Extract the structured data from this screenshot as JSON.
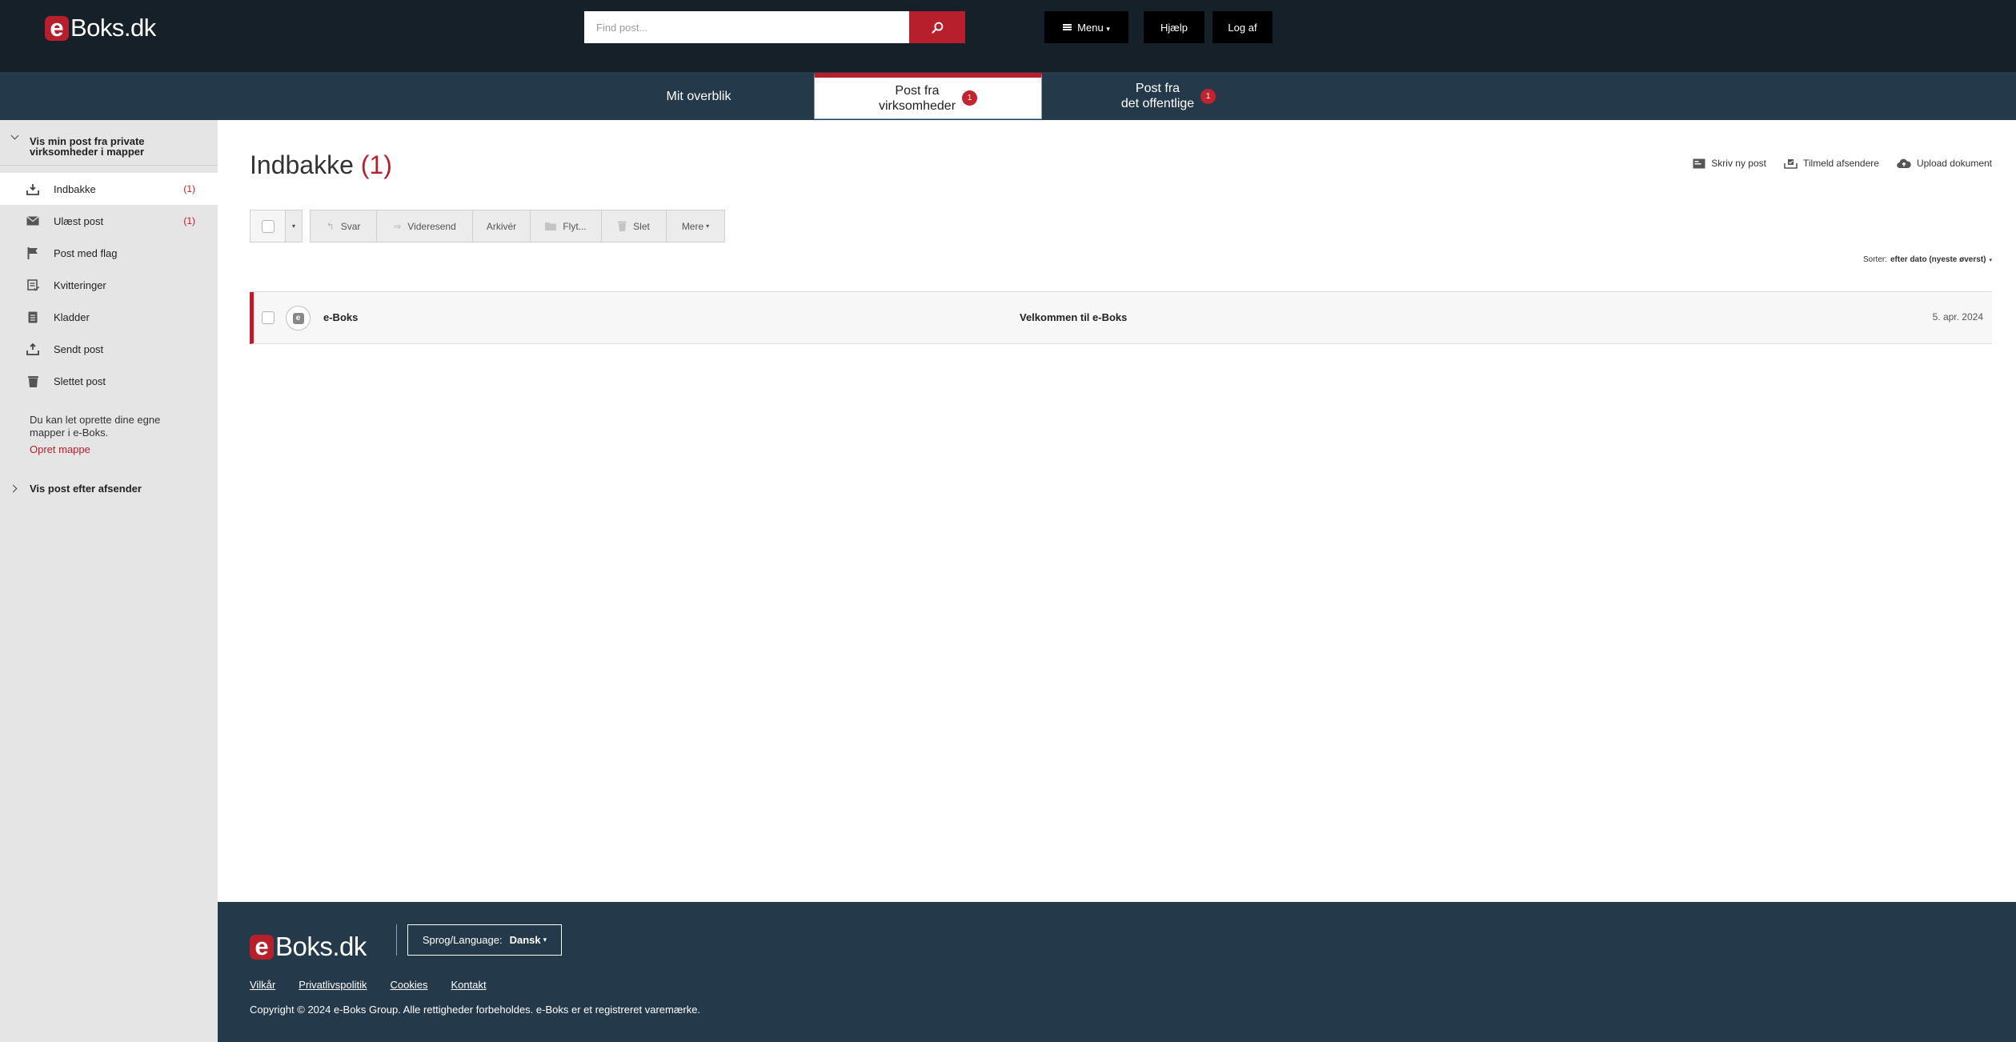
{
  "brand": {
    "logo_e": "e",
    "logo_rest": "Boks.dk",
    "accent": "#b81f2d",
    "header_bg": "#162029",
    "nav_bg": "#24394a"
  },
  "header": {
    "search_placeholder": "Find post...",
    "search_icon": "search-icon",
    "menu_label": "Menu",
    "menu_caret": "▾",
    "help_label": "Hjælp",
    "logout_label": "Log af"
  },
  "tabs": [
    {
      "label": "Mit overblik",
      "badge": "",
      "active": false
    },
    {
      "label_line1": "Post fra",
      "label_line2": "virksomheder",
      "badge": "1",
      "active": true
    },
    {
      "label_line1": "Post fra",
      "label_line2": "det offentlige",
      "badge": "1",
      "active": false
    }
  ],
  "sidebar": {
    "section_title": "Vis min post fra private virksomheder i mapper",
    "items": [
      {
        "label": "Indbakke",
        "count": "(1)",
        "icon": "inbox-download-icon",
        "active": true
      },
      {
        "label": "Ulæst post",
        "count": "(1)",
        "icon": "envelope-icon",
        "active": false
      },
      {
        "label": "Post med flag",
        "count": "",
        "icon": "flag-icon",
        "active": false
      },
      {
        "label": "Kvitteringer",
        "count": "",
        "icon": "receipt-icon",
        "active": false
      },
      {
        "label": "Kladder",
        "count": "",
        "icon": "draft-icon",
        "active": false
      },
      {
        "label": "Sendt post",
        "count": "",
        "icon": "outbox-upload-icon",
        "active": false
      },
      {
        "label": "Slettet post",
        "count": "",
        "icon": "trash-icon",
        "active": false
      }
    ],
    "folder_note": "Du kan let oprette dine egne mapper i e-Boks.",
    "create_folder_link": "Opret mappe",
    "by_sender_title": "Vis post efter afsender"
  },
  "main": {
    "title": "Indbakke",
    "title_count": "(1)",
    "actions": [
      {
        "label": "Skriv ny post",
        "icon": "compose-icon"
      },
      {
        "label": "Tilmeld afsendere",
        "icon": "subscribe-icon"
      },
      {
        "label": "Upload dokument",
        "icon": "cloud-upload-icon"
      }
    ],
    "toolbar": {
      "select_caret": "▾",
      "reply_label": "Svar",
      "forward_label": "Videresend",
      "archive_label": "Arkivér",
      "move_label": "Flyt...",
      "delete_label": "Slet",
      "more_label": "Mere",
      "more_caret": "▾"
    },
    "sort_prefix": "Sorter:",
    "sort_value": "efter dato (nyeste øverst)",
    "sort_caret": "▾",
    "messages": [
      {
        "sender": "e-Boks",
        "subject": "Velkommen til e-Boks",
        "date": "5. apr. 2024",
        "avatar_letter": "e"
      }
    ]
  },
  "footer": {
    "lang_prefix": "Sprog/Language:",
    "lang_value": "Dansk",
    "lang_caret": "▾",
    "links": [
      "Vilkår",
      "Privatlivspolitik",
      "Cookies",
      "Kontakt"
    ],
    "copyright": "Copyright © 2024 e-Boks Group. Alle rettigheder forbeholdes. e-Boks er et registreret varemærke."
  }
}
